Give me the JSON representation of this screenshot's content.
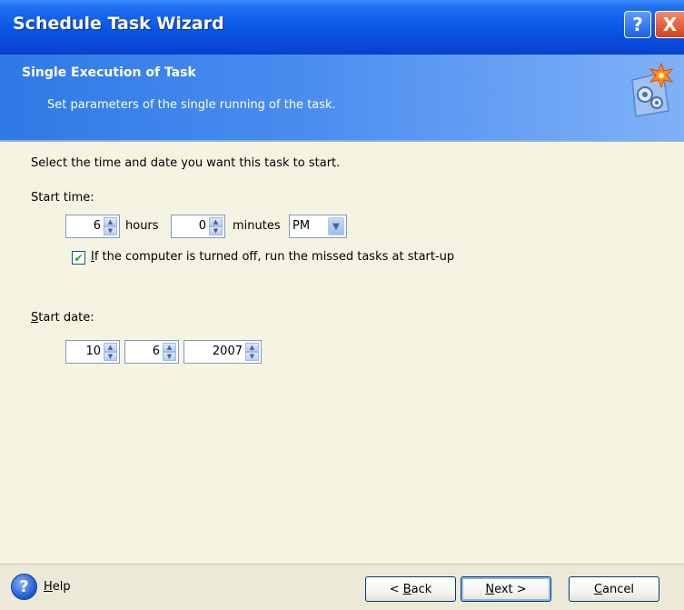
{
  "window": {
    "title": "Schedule Task Wizard",
    "help_button": "?",
    "close_button": "X"
  },
  "header": {
    "title": "Single Execution of Task",
    "subtitle": "Set parameters of the single running of the task.",
    "icon": "task-settings-gears-icon"
  },
  "content": {
    "instruction": "Select the time and date you want this task to start.",
    "start_time": {
      "label_prefix": "",
      "label_rest": "Start time:",
      "hours_value": "6",
      "hours_label": "hours",
      "minutes_value": "0",
      "minutes_label": "minutes",
      "ampm_value": "PM"
    },
    "missed_tasks": {
      "checked": true,
      "label_accel": "I",
      "label_rest": "f the computer is turned off, run the missed tasks at start-up"
    },
    "start_date": {
      "label_accel": "S",
      "label_rest": "tart date:",
      "month_value": "10",
      "day_value": "6",
      "year_value": "2007"
    }
  },
  "footer": {
    "help_label_accel": "H",
    "help_label_rest": "elp",
    "back_prefix": "< ",
    "back_accel": "B",
    "back_rest": "ack",
    "next_accel": "N",
    "next_rest": "ext >",
    "cancel_accel": "C",
    "cancel_rest": "ancel"
  },
  "colors": {
    "titlebar": "#0a55e4",
    "header": "#4a8df0",
    "body": "#f5f3e1",
    "footer": "#ece9d8",
    "check": "#21a121"
  }
}
